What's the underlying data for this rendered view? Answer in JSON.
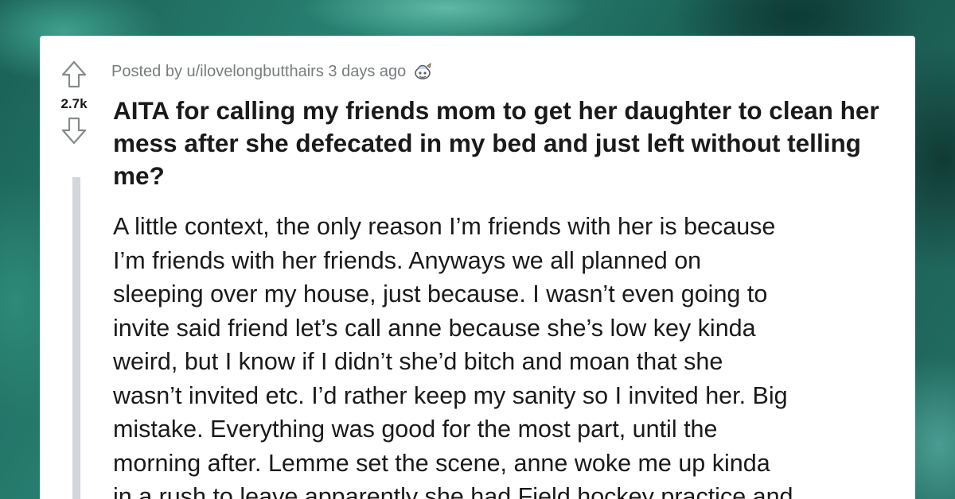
{
  "post": {
    "score": "2.7k",
    "author_line": "Posted by u/ilovelongbutthairs 3 days ago",
    "title": "AITA for calling my friends mom to get her daughter to clean her mess after she defecated in my bed and just left without telling me?",
    "body_lines": [
      "A little context, the only reason I’m friends with her is because",
      "I’m friends with her friends. Anyways we all planned on",
      "sleeping over my house, just because. I wasn’t even going to",
      "invite said friend let’s call anne because she’s low key kinda",
      "weird, but I know if I didn’t she’d bitch and moan that she",
      "wasn’t invited etc. I’d rather keep my sanity so I invited her. Big",
      "mistake. Everything was good for the most part, until the",
      "morning after. Lemme set the scene, anne woke me up kinda",
      "in a rush to leave apparently she had Field hockey practice and"
    ]
  },
  "icons": {
    "upvote": "upvote-arrow-icon",
    "downvote": "downvote-arrow-icon",
    "award": "award-icon"
  },
  "colors": {
    "card": "#ffffff",
    "text": "#1a1a1b",
    "meta": "#787c7e",
    "thread_line": "#d3d6da",
    "background": "#1f6f63"
  }
}
